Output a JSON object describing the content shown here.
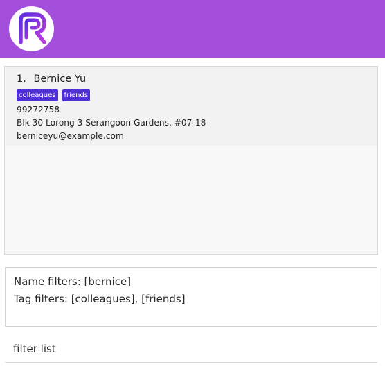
{
  "header": {
    "logo_icon": "r-logo-icon",
    "background_color": "#a34fdc"
  },
  "person_list": {
    "items": [
      {
        "index": "1.",
        "name": "Bernice Yu",
        "tags": [
          "colleagues",
          "friends"
        ],
        "phone": "99272758",
        "address": "Blk 30 Lorong 3 Serangoon Gardens, #07-18",
        "email": "berniceyu@example.com"
      }
    ],
    "tag_color": "#4f2fd8"
  },
  "result_display": {
    "line1": "Name filters: [bernice]",
    "line2": "Tag filters: [colleagues], [friends]"
  },
  "command_box": {
    "value": "filter list"
  }
}
